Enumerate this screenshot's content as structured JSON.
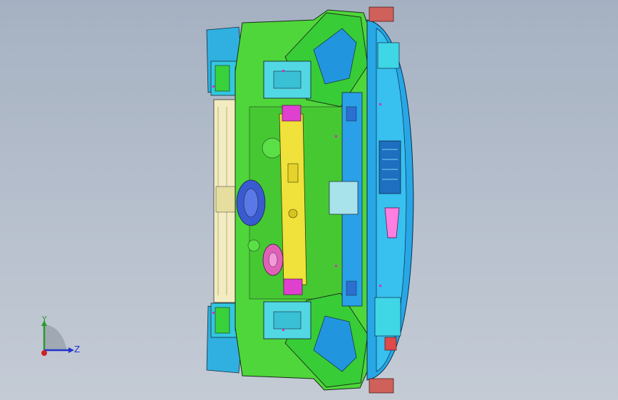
{
  "viewport": {
    "background_top": "#a5b1c2",
    "background_bottom": "#c4cbd5"
  },
  "model": {
    "description_icon": "car-front-subframe-assembly",
    "colors": {
      "green": "#4fd63a",
      "dark_green": "#2e9a22",
      "blue": "#27a7e6",
      "cyan": "#3fd6e6",
      "yellow": "#f0e23a",
      "magenta": "#e040d0",
      "cream": "#f3ecc0",
      "outline": "#1a2a1a"
    }
  },
  "triad": {
    "y_label": "Y",
    "z_label": "Z",
    "y_color": "#2a9a2a",
    "z_color": "#2233cc",
    "origin_color": "#cc2222"
  }
}
